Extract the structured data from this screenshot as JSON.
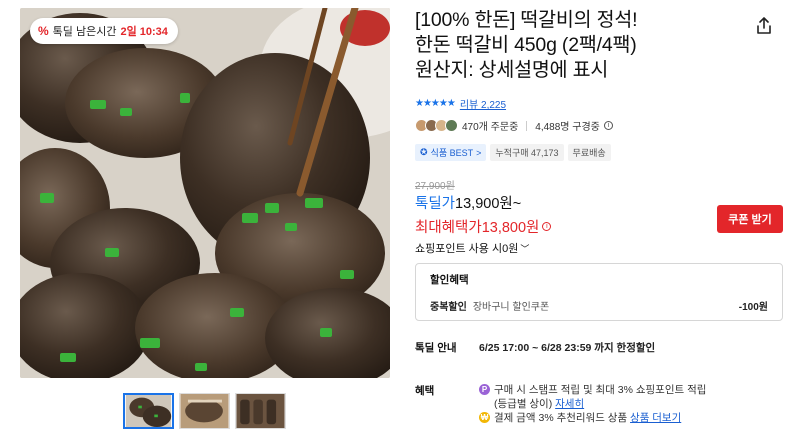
{
  "timer_badge": {
    "icon": "percent-tag-icon",
    "label": "톡딜 남은시간",
    "time": "2일 10:34"
  },
  "product": {
    "title": "[100% 한돈] 떡갈비의 정석!\n한돈 떡갈비 450g (2팩/4팩)\n원산지: 상세설명에 표시",
    "rating_stars": "★★★★★",
    "rating": 4.5,
    "review_label": "리뷰 2,225",
    "order_count": "470개 주문중",
    "watch_count": "4,488명 구경중",
    "badges": {
      "best": "식품 BEST",
      "best_arrow": ">",
      "cumulative": "누적구매 47,173",
      "shipping": "무료배송"
    },
    "original_price": "27,900원",
    "deal_label": "톡딜가",
    "deal_price": "13,900원~",
    "max_benefit": "최대혜택가13,800원",
    "coupon_button": "쿠폰 받기",
    "point_use": "쇼핑포인트 사용 시0원"
  },
  "discount": {
    "title": "할인혜택",
    "row_key": "중복할인",
    "row_value": "장바구니 할인쿠폰",
    "row_amount": "-100원"
  },
  "deal_info": {
    "label": "톡딜 안내",
    "dates": "6/25 17:00 ~ 6/28 23:59 까지 한정할인"
  },
  "benefits": {
    "label": "혜택",
    "item1_text": "구매 시 스탬프 적립 및 최대 3% 쇼핑포인트 적립",
    "item1_sub": "(등급별 상이)",
    "item1_link": "자세히",
    "item2_text": "결제 금액 3% 추천리워드 상품",
    "item2_link": "상품 더보기"
  },
  "colors": {
    "accent_blue": "#1a73e8",
    "deal_red": "#e3262a"
  }
}
